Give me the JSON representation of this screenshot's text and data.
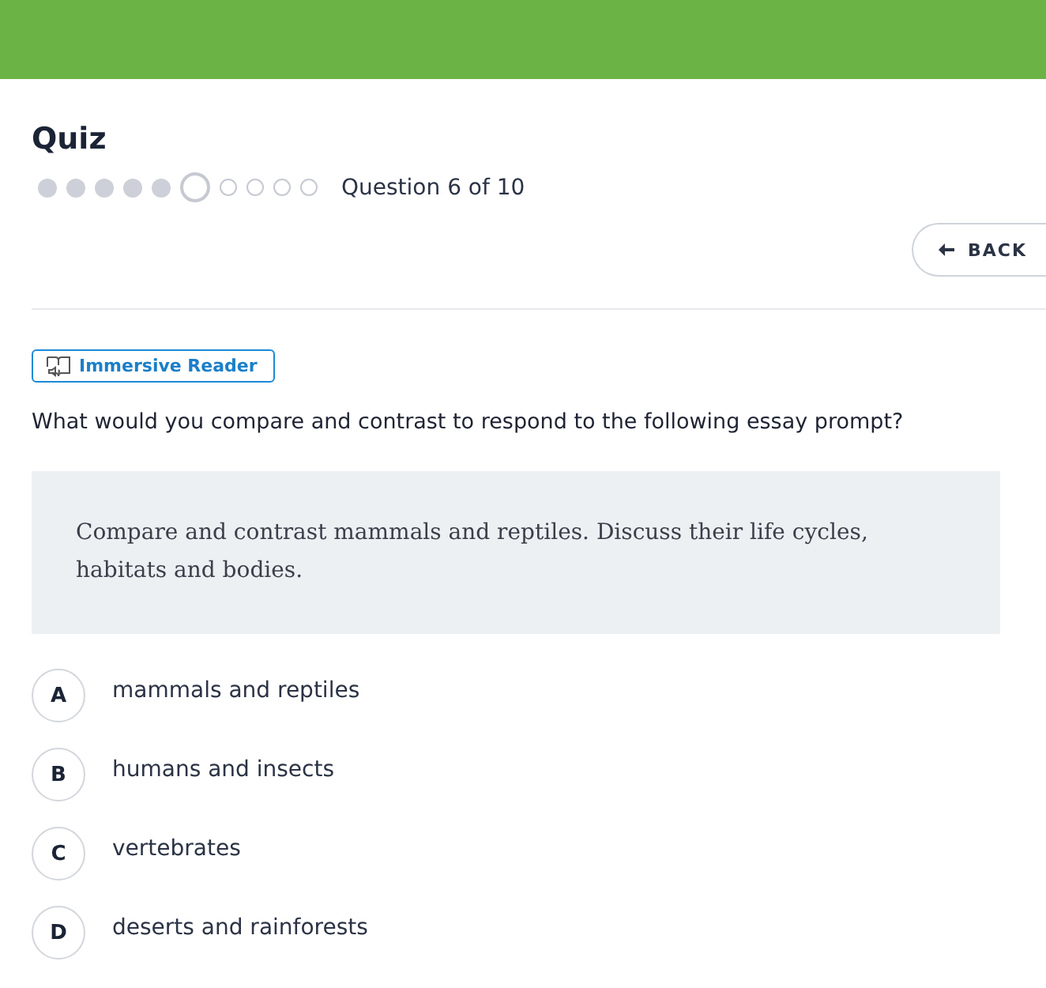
{
  "header": {
    "kind": "banner"
  },
  "quiz": {
    "title": "Quiz",
    "progress": [
      {
        "kind": "done"
      },
      {
        "kind": "done"
      },
      {
        "kind": "done"
      },
      {
        "kind": "done"
      },
      {
        "kind": "done"
      },
      {
        "kind": "current"
      },
      {
        "kind": "todo"
      },
      {
        "kind": "todo"
      },
      {
        "kind": "todo"
      },
      {
        "kind": "todo"
      }
    ],
    "progress_label": "Question 6 of 10",
    "back_button": "BACK"
  },
  "reader_button": "Immersive Reader",
  "question": "What would you compare and contrast to respond to the following essay prompt?",
  "prompt": "Compare and contrast mammals and reptiles. Discuss their life cycles, habitats and bodies.",
  "answers": [
    {
      "letter": "A",
      "text": "mammals and reptiles",
      "selected": false
    },
    {
      "letter": "B",
      "text": "humans and insects",
      "selected": false
    },
    {
      "letter": "C",
      "text": "vertebrates",
      "selected": false
    },
    {
      "letter": "D",
      "text": "deserts and rainforests",
      "selected": false
    }
  ]
}
